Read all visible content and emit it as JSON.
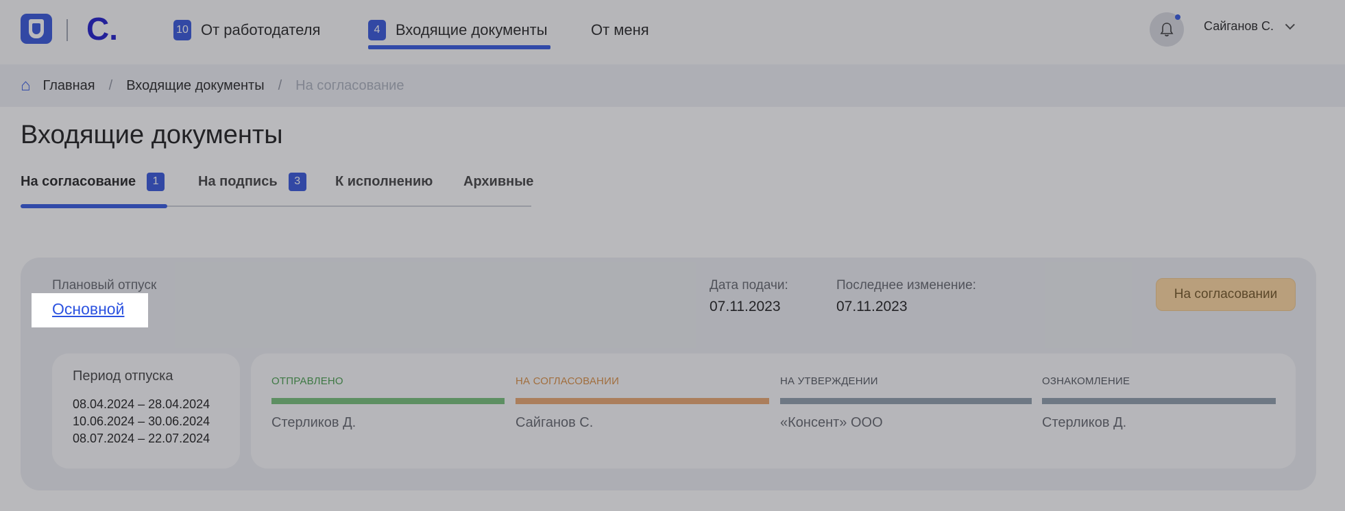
{
  "colors": {
    "accent": "#2b52e0",
    "brand_logo": "#1512c8",
    "status_bg": "#ffd79c",
    "stage_sent": "#3e9a43",
    "stage_approval": "#d98a3a",
    "stage_pending": "#8a9aa8"
  },
  "header": {
    "logo_text": "С.",
    "nav": [
      {
        "badge": "10",
        "label": "От работодателя"
      },
      {
        "badge": "4",
        "label": "Входящие документы"
      },
      {
        "badge": "",
        "label": "От меня"
      }
    ],
    "user_name": "Сайганов С."
  },
  "breadcrumb": {
    "items": [
      "Главная",
      "Входящие документы",
      "На согласование"
    ]
  },
  "page_title": "Входящие документы",
  "tabs": [
    {
      "label": "На согласование",
      "badge": "1"
    },
    {
      "label": "На подпись",
      "badge": "3"
    },
    {
      "label": "К исполнению",
      "badge": ""
    },
    {
      "label": "Архивные",
      "badge": ""
    }
  ],
  "document": {
    "type": "Плановый отпуск",
    "name": "Основной",
    "submitted_label": "Дата подачи:",
    "submitted_value": "07.11.2023",
    "modified_label": "Последнее изменение:",
    "modified_value": "07.11.2023",
    "status": "На согласовании",
    "period_title": "Период отпуска",
    "periods": [
      "08.04.2024 – 28.04.2024",
      "10.06.2024 – 30.06.2024",
      "08.07.2024 – 22.07.2024"
    ],
    "stages": [
      {
        "label": "ОТПРАВЛЕНО",
        "person": "Стерликов Д."
      },
      {
        "label": "НА СОГЛАСОВАНИИ",
        "person": "Сайганов С."
      },
      {
        "label": "НА УТВЕРЖДЕНИИ",
        "person": "«Консент» ООО"
      },
      {
        "label": "ОЗНАКОМЛЕНИЕ",
        "person": "Стерликов Д."
      }
    ]
  }
}
